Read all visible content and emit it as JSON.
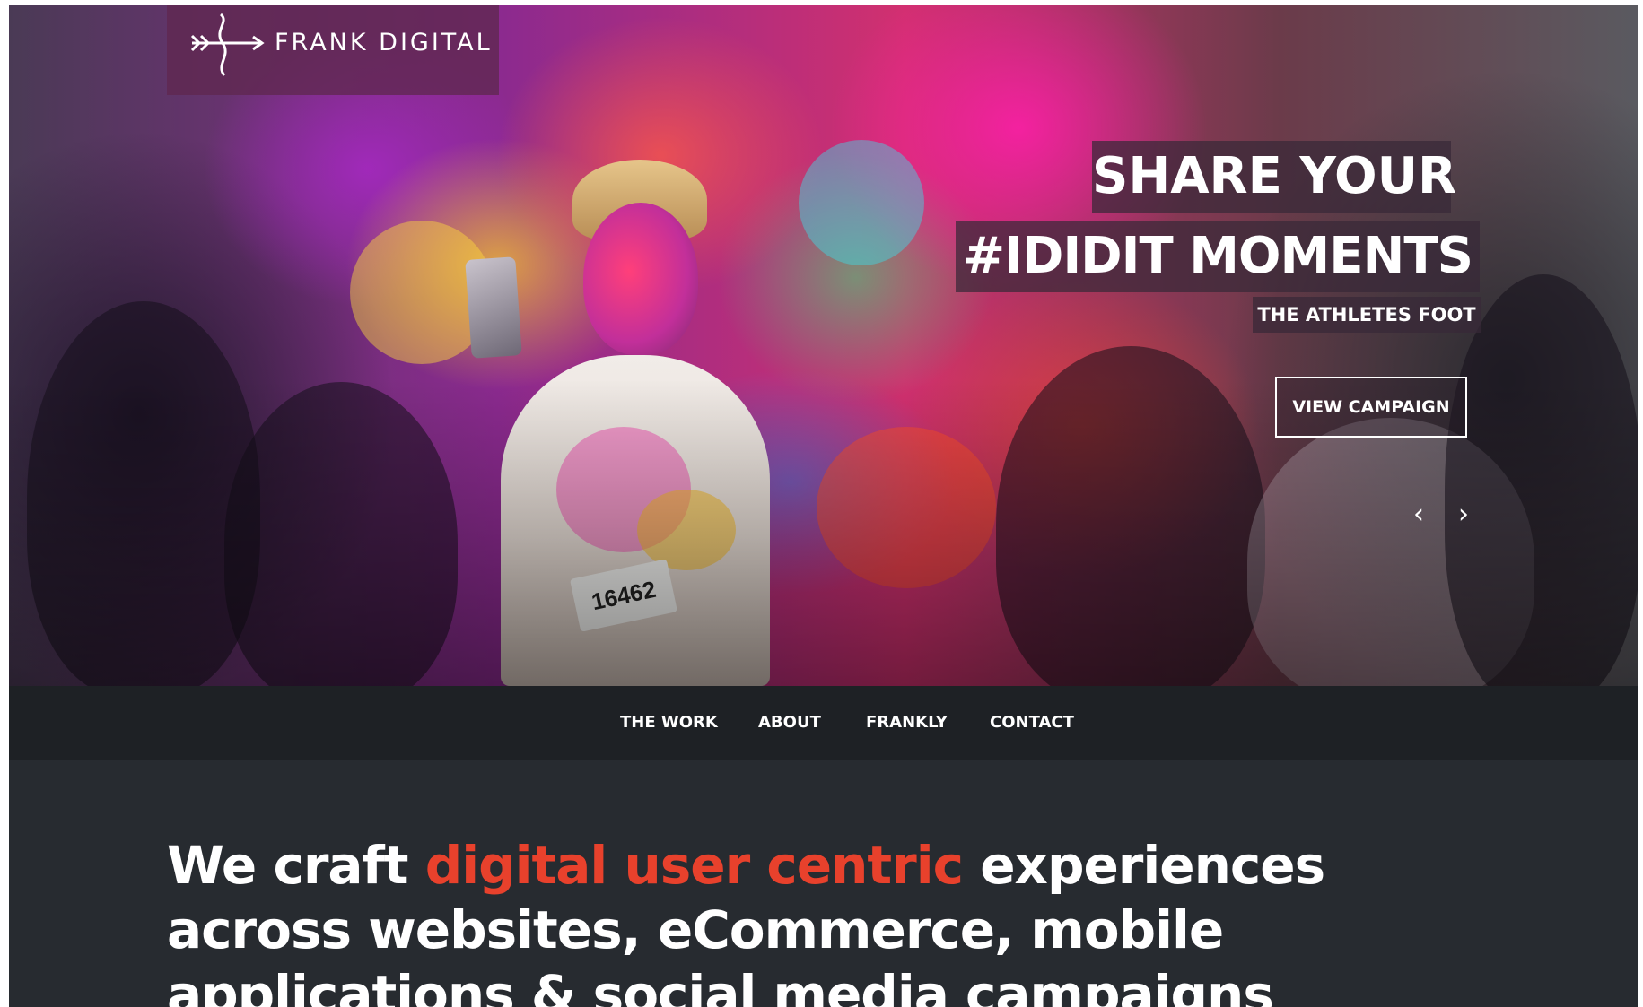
{
  "brand": {
    "logo_text": "FRANK DIGITAL"
  },
  "hero": {
    "headline_line1": "SHARE YOUR",
    "headline_line2": "#IDIDIT MOMENTS",
    "client": "THE ATHLETES FOOT",
    "cta_label": "VIEW CAMPAIGN",
    "bib_number": "16462",
    "prev_icon": "chevron-left-icon",
    "next_icon": "chevron-right-icon"
  },
  "nav": {
    "items": [
      {
        "label": "THE WORK"
      },
      {
        "label": "ABOUT"
      },
      {
        "label": "FRANKLY"
      },
      {
        "label": "CONTACT"
      }
    ]
  },
  "intro": {
    "text_before": "We craft ",
    "text_accent": "digital user centric",
    "text_after": " experiences across websites, eCommerce, mobile applications & social media campaigns"
  },
  "colors": {
    "accent": "#e8412c",
    "nav_bg": "#1e2125",
    "body_bg": "#272b30"
  }
}
